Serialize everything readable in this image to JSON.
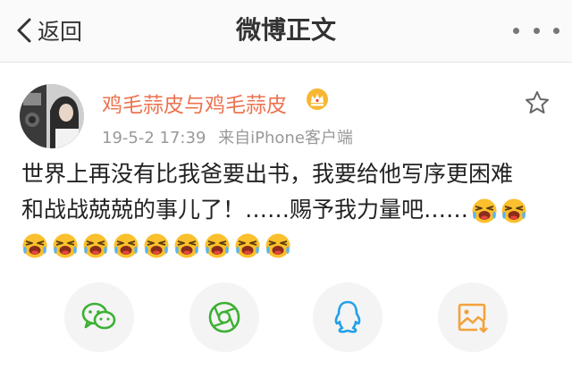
{
  "navbar": {
    "back_label": "返回",
    "title": "微博正文",
    "back_icon": "chevron-left-icon",
    "more_icon": "more-dots-icon"
  },
  "post": {
    "user_name": "鸡毛蒜皮与鸡毛蒜皮",
    "user_badge_icon": "crown-icon",
    "timestamp": "19-5-2 17:39",
    "source": "来自iPhone客户端",
    "favorite_icon": "star-outline-icon",
    "text_line1": "世界上再没有比我爸要出书，我要给他写序更困难",
    "text_line2": "和战战兢兢的事儿了！……赐予我力量吧……",
    "emoji_name": "crying-laughing-emoji",
    "trailing_emoji_count": 2,
    "next_line_emoji_count": 9
  },
  "share": {
    "targets": [
      {
        "name": "wechat",
        "icon": "wechat-icon",
        "color": "#3cb034"
      },
      {
        "name": "moments",
        "icon": "moments-icon",
        "color": "#3cb034"
      },
      {
        "name": "qq",
        "icon": "qq-icon",
        "color": "#21a0e8"
      },
      {
        "name": "save-image",
        "icon": "save-image-icon",
        "color": "#f2a23a"
      }
    ]
  },
  "colors": {
    "username": "#eb7350",
    "meta": "#999999",
    "accent_orange": "#f5a623"
  }
}
